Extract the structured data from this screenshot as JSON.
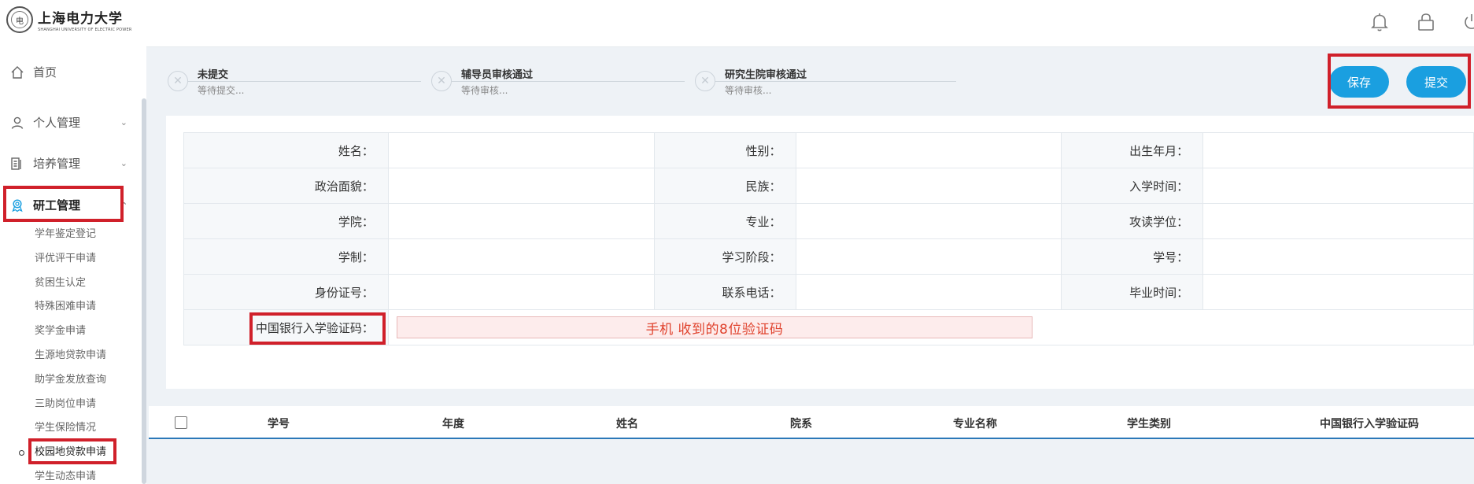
{
  "university": {
    "name_cn": "上海电力大学",
    "name_en": "SHANGHAI UNIVERSITY OF ELECTRIC POWER",
    "seal_char": "电"
  },
  "sidebar": {
    "nav": [
      {
        "label": "首页",
        "icon": "home-icon"
      },
      {
        "label": "个人管理",
        "icon": "user-icon"
      },
      {
        "label": "培养管理",
        "icon": "book-icon"
      },
      {
        "label": "研工管理",
        "icon": "award-icon"
      }
    ],
    "submenu": [
      "学年鉴定登记",
      "评优评干申请",
      "贫困生认定",
      "特殊困难申请",
      "奖学金申请",
      "生源地贷款申请",
      "助学金发放查询",
      "三助岗位申请",
      "学生保险情况",
      "校园地贷款申请",
      "学生动态申请"
    ],
    "current_submenu_index": 9
  },
  "workflow": {
    "steps": [
      {
        "title": "未提交",
        "status": "等待提交..."
      },
      {
        "title": "辅导员审核通过",
        "status": "等待审核..."
      },
      {
        "title": "研究生院审核通过",
        "status": "等待审核..."
      }
    ]
  },
  "actions": {
    "save": "保存",
    "submit": "提交"
  },
  "form": {
    "rows": [
      [
        "姓名：",
        "性别：",
        "出生年月："
      ],
      [
        "政治面貌：",
        "民族：",
        "入学时间："
      ],
      [
        "学院：",
        "专业：",
        "攻读学位："
      ],
      [
        "学制：",
        "学习阶段：",
        "学号："
      ],
      [
        "身份证号：",
        "联系电话：",
        "毕业时间："
      ]
    ],
    "verify_label": "中国银行入学验证码：",
    "verify_placeholder": "手机        收到的8位验证码"
  },
  "list": {
    "columns": [
      "学号",
      "年度",
      "姓名",
      "院系",
      "专业名称",
      "学生类别",
      "中国银行入学验证码"
    ]
  },
  "colors": {
    "accent": "#1a9fe0",
    "highlight_red": "#d0202a",
    "table_header_rule": "#2b78b8"
  }
}
